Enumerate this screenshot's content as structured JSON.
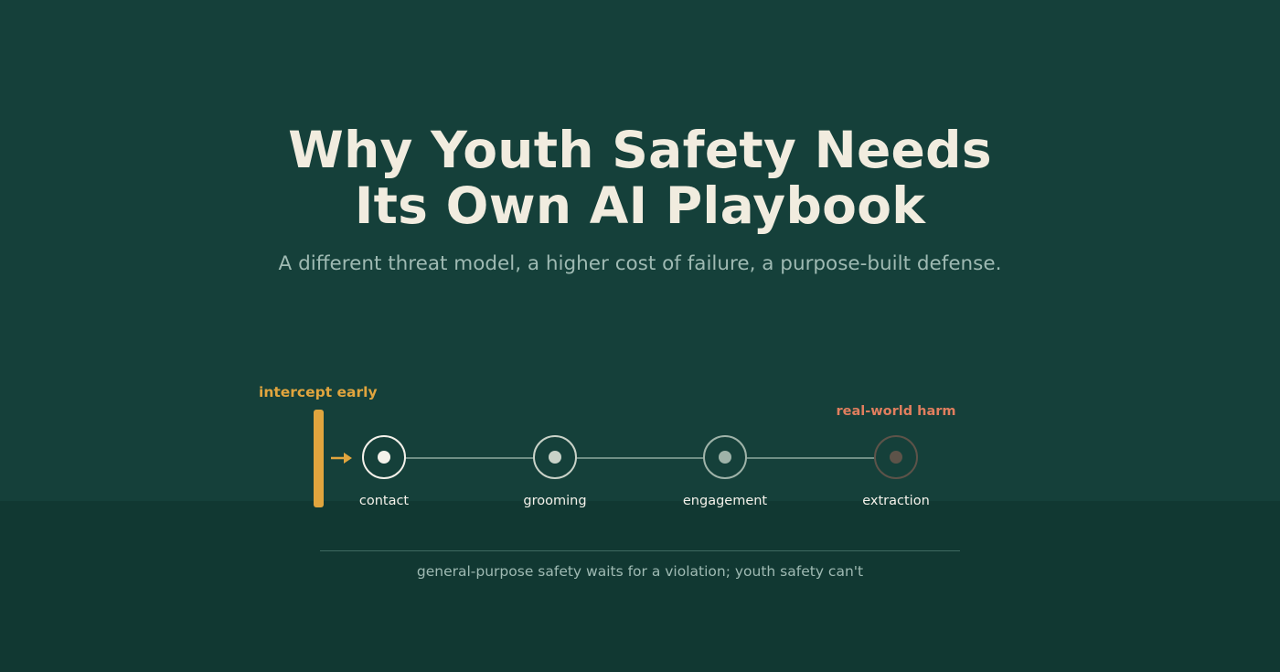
{
  "title_lines": [
    "Why Youth Safety Needs",
    "Its Own AI Playbook"
  ],
  "subtitle": "A different threat model, a higher cost of failure, a purpose-built defense.",
  "diagram": {
    "intercept_label": "intercept early",
    "harm_label": "real-world harm",
    "stages": [
      {
        "label": "contact",
        "ring_color": "#f4f1ea",
        "dot_color": "#f4f1ea"
      },
      {
        "label": "grooming",
        "ring_color": "#c9d2c8",
        "dot_color": "#c9d2c8"
      },
      {
        "label": "engagement",
        "ring_color": "#9fb3a9",
        "dot_color": "#9fb3a9"
      },
      {
        "label": "extraction",
        "ring_color": "#5d5349",
        "dot_color": "#5d5349"
      }
    ],
    "colors": {
      "accent": "#e1a53e",
      "harm": "#e07e5e",
      "connector": "#6f8f85"
    }
  },
  "caption": "general-purpose safety waits for a violation; youth safety can't"
}
